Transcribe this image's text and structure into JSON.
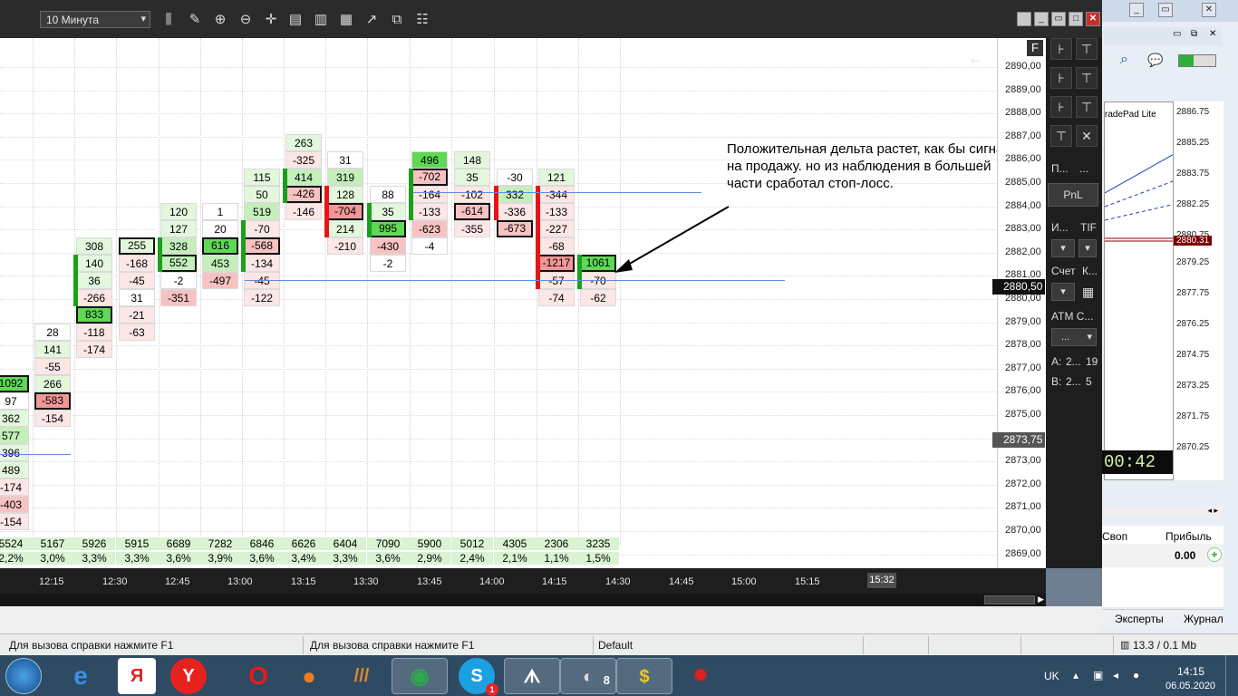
{
  "toolbar": {
    "timeframe": "10 Минута"
  },
  "chart": {
    "annotation": "Положительная дельта растет, как бы сигнал на продажу. но из наблюдения   в большей части сработал стоп-лосс.",
    "price_levels": [
      "2890,00",
      "2889,00",
      "2888,00",
      "2887,00",
      "2886,00",
      "2885,00",
      "2884,00",
      "2883,00",
      "2882,00",
      "2881,00",
      "2880,00",
      "2879,00",
      "2878,00",
      "2877,00",
      "2876,00",
      "2875,00",
      "2874,00",
      "2873,00",
      "2872,00",
      "2871,00",
      "2870,00",
      "2869,00"
    ],
    "current_price": "2880,50",
    "mark_price": "2873,75",
    "time_labels": [
      "12:15",
      "12:30",
      "12:45",
      "13:00",
      "13:15",
      "13:30",
      "13:45",
      "14:00",
      "14:15",
      "14:30",
      "14:45",
      "15:00",
      "15:15"
    ],
    "time_cursor": "15:32",
    "volumes": [
      "5524",
      "5167",
      "5926",
      "5915",
      "6689",
      "7282",
      "6846",
      "6626",
      "6404",
      "7090",
      "5900",
      "5012",
      "4305",
      "2306",
      "3235"
    ],
    "volume_pct": [
      "2,2%",
      "3,0%",
      "3,3%",
      "3,3%",
      "3,6%",
      "3,9%",
      "3,6%",
      "3,4%",
      "3,3%",
      "3,6%",
      "2,9%",
      "2,4%",
      "2,1%",
      "1,1%",
      "1,5%"
    ]
  },
  "right_panel": {
    "labels": {
      "pos_label": "П...",
      "pos_value": "...",
      "pnl": "PnL",
      "instrument": "И...",
      "tif": "TIF",
      "account": "Счет",
      "account_k": "К...",
      "atm": "ATM C...",
      "atm_value": "...",
      "ask_label": "A:",
      "ask_price": "2...",
      "ask_qty": "19",
      "bid_label": "B:",
      "bid_price": "2...",
      "bid_qty": "5"
    },
    "clock": "00:42"
  },
  "side_window": {
    "chart_title": "radePad Lite",
    "ticks": [
      "2886.75",
      "2885.25",
      "2883.75",
      "2882.25",
      "2880.75",
      "2880.31",
      "2879.25",
      "2877.75",
      "2876.25",
      "2874.75",
      "2873.25",
      "2871.75",
      "2870.25"
    ],
    "col_swap": "Своп",
    "col_profit": "Прибыль",
    "profit_value": "0.00",
    "tab_experts": "Эксперты",
    "tab_journal": "Журнал",
    "net_speed": "13.3 / 0.1 Mb"
  },
  "status": {
    "help1": "Для вызова справки нажмите F1",
    "help2": "Для вызова справки нажмите F1",
    "profile": "Default"
  },
  "taskbar": {
    "lang": "UK",
    "time": "14:15",
    "date": "06.05.2020",
    "yandex_label": "Я",
    "skype_badge": "1",
    "app8_badge": "8"
  }
}
